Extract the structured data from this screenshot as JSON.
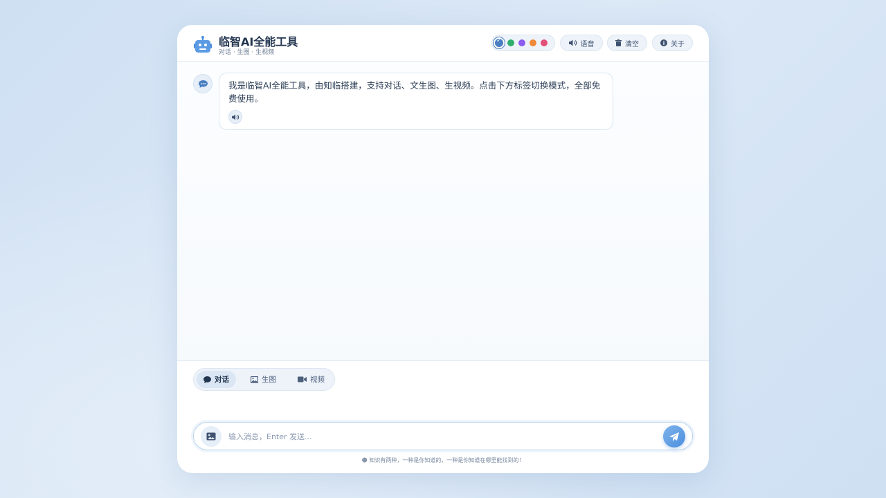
{
  "header": {
    "title": "临智AI全能工具",
    "subtitle": "对话 · 生图 · 生视频",
    "theme_colors": [
      "#4a7fc1",
      "#2fae6e",
      "#8c5cf0",
      "#f08a3a",
      "#e2507a"
    ],
    "selected_theme": 0,
    "voice_label": "语音",
    "clear_label": "清空",
    "about_label": "关于"
  },
  "messages": [
    {
      "role": "assistant",
      "text": "我是临智AI全能工具，由知临搭建，支持对话、文生图、生视频。点击下方标签切换模式，全部免费使用。"
    }
  ],
  "tabs": [
    {
      "label": "对话",
      "icon": "chat-bubble-icon",
      "active": true
    },
    {
      "label": "生图",
      "icon": "image-icon",
      "active": false
    },
    {
      "label": "视频",
      "icon": "video-camera-icon",
      "active": false
    }
  ],
  "input": {
    "placeholder": "输入消息，Enter 发送...",
    "value": ""
  },
  "footer": {
    "text": "知识有两种，一种是你知道的，一种是你知道在哪里能找到的！"
  }
}
